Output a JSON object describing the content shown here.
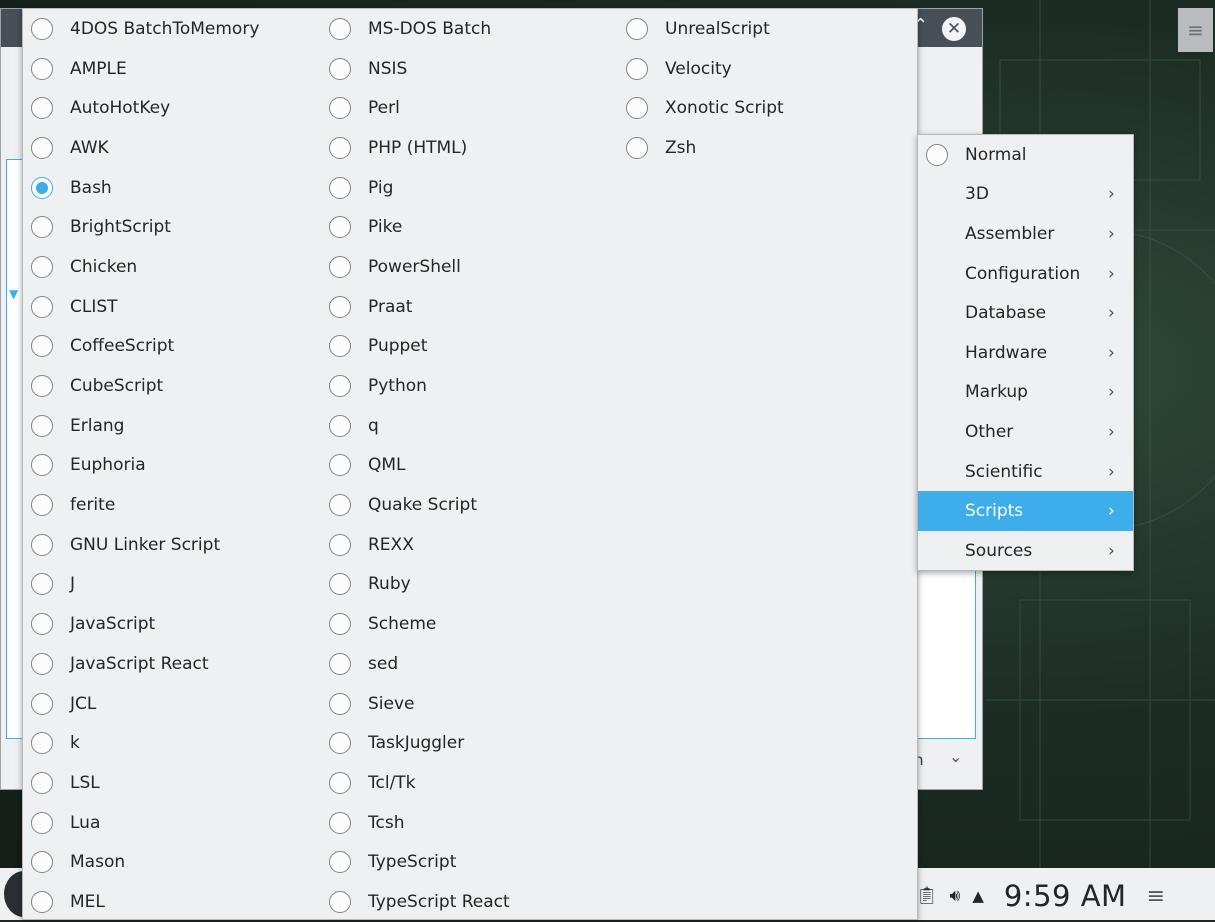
{
  "main_menu": {
    "columns": [
      [
        "4DOS BatchToMemory",
        "AMPLE",
        "AutoHotKey",
        "AWK",
        "Bash",
        "BrightScript",
        "Chicken",
        "CLIST",
        "CoffeeScript",
        "CubeScript",
        "Erlang",
        "Euphoria",
        "ferite",
        "GNU Linker Script",
        "J",
        "JavaScript",
        "JavaScript React",
        "JCL",
        "k",
        "LSL",
        "Lua",
        "Mason",
        "MEL"
      ],
      [
        "MS-DOS Batch",
        "NSIS",
        "Perl",
        "PHP (HTML)",
        "Pig",
        "Pike",
        "PowerShell",
        "Praat",
        "Puppet",
        "Python",
        "q",
        "QML",
        "Quake Script",
        "REXX",
        "Ruby",
        "Scheme",
        "sed",
        "Sieve",
        "TaskJuggler",
        "Tcl/Tk",
        "Tcsh",
        "TypeScript",
        "TypeScript React"
      ],
      [
        "UnrealScript",
        "Velocity",
        "Xonotic Script",
        "Zsh"
      ]
    ],
    "selected": "Bash"
  },
  "sub_menu": {
    "items": [
      {
        "label": "Normal",
        "type": "radio"
      },
      {
        "label": "3D",
        "type": "submenu"
      },
      {
        "label": "Assembler",
        "type": "submenu"
      },
      {
        "label": "Configuration",
        "type": "submenu"
      },
      {
        "label": "Database",
        "type": "submenu"
      },
      {
        "label": "Hardware",
        "type": "submenu"
      },
      {
        "label": "Markup",
        "type": "submenu"
      },
      {
        "label": "Other",
        "type": "submenu"
      },
      {
        "label": "Scientific",
        "type": "submenu"
      },
      {
        "label": "Scripts",
        "type": "submenu",
        "active": true
      },
      {
        "label": "Sources",
        "type": "submenu"
      }
    ]
  },
  "app_window": {
    "partial_combo_text": "n"
  },
  "taskbar": {
    "clock": "9:59 AM"
  },
  "colors": {
    "accent": "#3daee9",
    "menu_bg": "#eff0f1",
    "titlebar": "#475057"
  }
}
